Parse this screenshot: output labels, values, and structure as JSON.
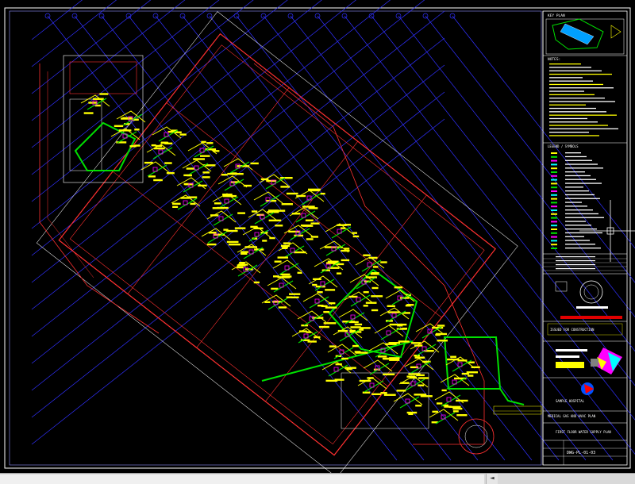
{
  "titleblock": {
    "key_plan_heading": "KEY PLAN",
    "notes_heading": "NOTES:",
    "legend_heading": "LEGEND / SYMBOLS",
    "client_name": "SAMPLE HOSPITAL",
    "project_name": "MEDICAL GAS AND HVAC PLAN",
    "drawing_title": "FIRST FLOOR WATER SUPPLY PLAN",
    "sheet_number": "DWG-PL-01-03",
    "stamp_text": "ISSUED FOR CONSTRUCTION"
  },
  "colors": {
    "frame": "#ffffff",
    "walls": "#ff3030",
    "grid": "#3030ff",
    "pipes_yellow": "#ffff00",
    "pipes_green": "#00e000",
    "background": "#000000"
  },
  "icons": {
    "crosshair": "crosshair-cursor-icon",
    "scroll_left": "arrow-left-icon"
  },
  "scrollbar": {
    "left_arrow": "◄"
  }
}
